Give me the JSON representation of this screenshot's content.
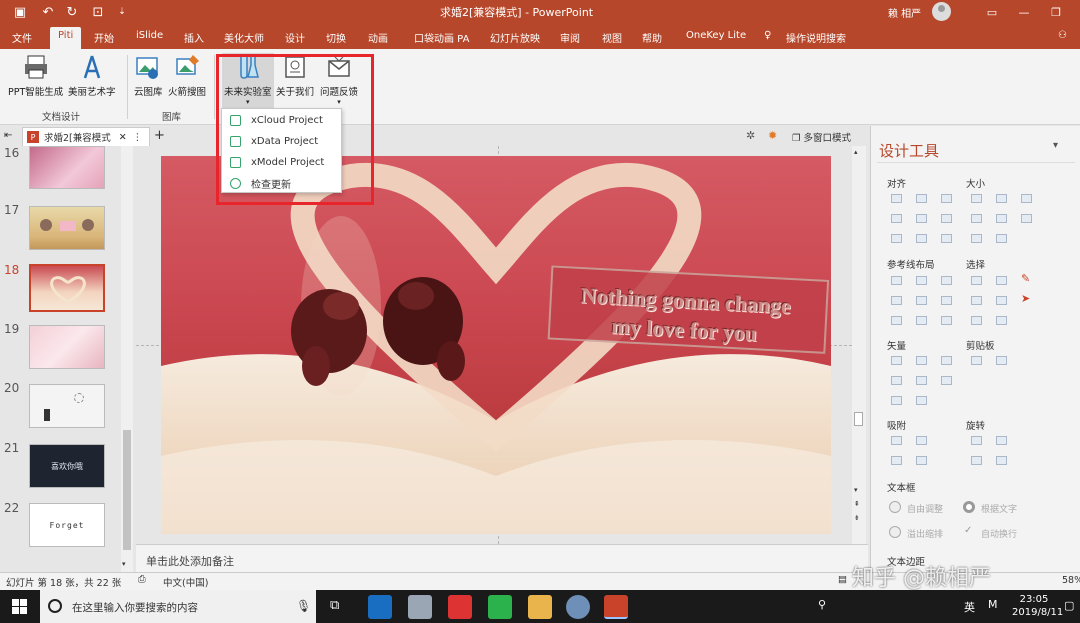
{
  "window": {
    "title": "求婚2[兼容模式] - PowerPoint",
    "user": "赖 相严",
    "min_icon": "minimize-icon",
    "restore_icon": "restore-icon"
  },
  "tabs": [
    {
      "label": "文件"
    },
    {
      "label": "Piti"
    },
    {
      "label": "开始"
    },
    {
      "label": "iSlide"
    },
    {
      "label": "插入"
    },
    {
      "label": "美化大师"
    },
    {
      "label": "设计"
    },
    {
      "label": "切换"
    },
    {
      "label": "动画"
    },
    {
      "label": "口袋动画 PA"
    },
    {
      "label": "幻灯片放映"
    },
    {
      "label": "审阅"
    },
    {
      "label": "视图"
    },
    {
      "label": "帮助"
    },
    {
      "label": "OneKey Lite"
    },
    {
      "label": "操作说明搜索"
    }
  ],
  "ribbon": {
    "ppt_gen": "PPT智能生成",
    "art_text": "美丽艺术字",
    "group_doc": "文档设计",
    "cloud_lib": "云图库",
    "rocket_search": "火箭搜图",
    "group_gallery": "图库",
    "future_lab": "未来实验室",
    "about_us": "关于我们",
    "feedback": "问题反馈"
  },
  "dropdown": {
    "items": [
      {
        "label": "xCloud Project"
      },
      {
        "label": "xData Project"
      },
      {
        "label": "xModel Project"
      },
      {
        "label": "检查更新"
      }
    ]
  },
  "doc_tab": {
    "name": "求婚2[兼容模式",
    "add": "+"
  },
  "view_controls": {
    "multi_window": "多窗口模式"
  },
  "thumbnails": [
    {
      "num": "16"
    },
    {
      "num": "17"
    },
    {
      "num": "18"
    },
    {
      "num": "19"
    },
    {
      "num": "20"
    },
    {
      "num": "21"
    },
    {
      "num": "22"
    }
  ],
  "thumb_texts": {
    "t21": "喜欢你哦",
    "t22": "Forget"
  },
  "slide": {
    "text_line1": "Nothing gonna change",
    "text_line2": "my love for you"
  },
  "notes_placeholder": "单击此处添加备注",
  "design_tools": {
    "title": "设计工具",
    "align": "对齐",
    "size": "大小",
    "guides": "参考线布局",
    "select": "选择",
    "vector": "矢量",
    "clipboard": "剪贴板",
    "snap": "吸附",
    "rotate": "旋转",
    "textbox": "文本框",
    "auto_adjust": "自由调整",
    "fit_text": "根据文字",
    "overflow_shrink": "溢出缩排",
    "auto_wrap": "自动换行",
    "margin": "文本边距"
  },
  "status": {
    "slide_info": "幻灯片 第 18 张，共 22 张",
    "language": "中文(中国)",
    "zoom": "58%"
  },
  "taskbar": {
    "search_placeholder": "在这里输入你要搜索的内容",
    "ime": "英",
    "time": "23:05",
    "date": "2019/8/11"
  },
  "watermark": "知乎 @赖相严"
}
